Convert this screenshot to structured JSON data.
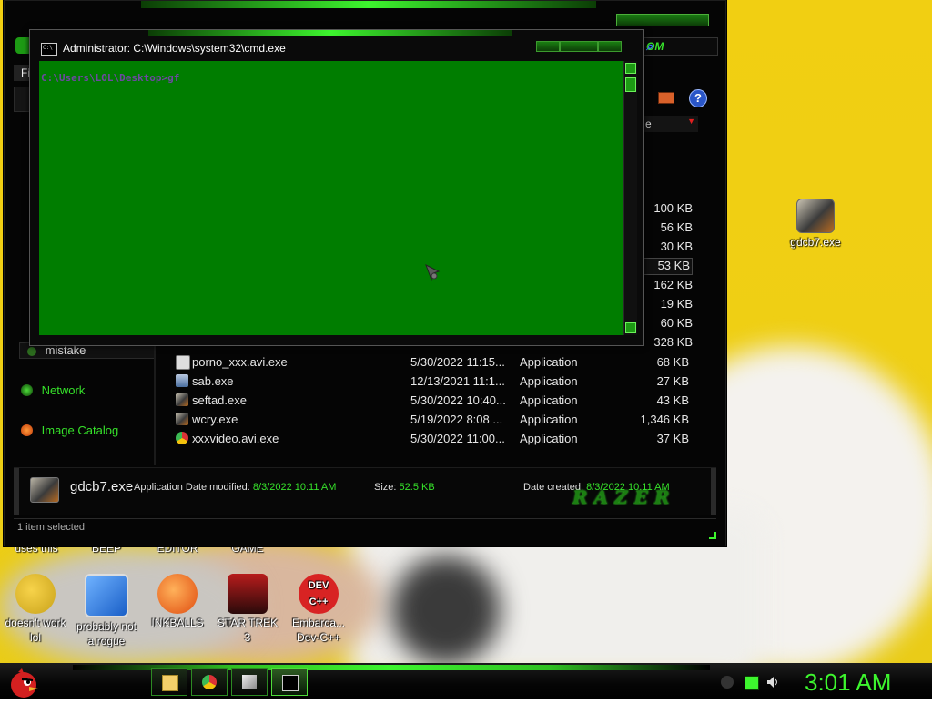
{
  "desktop": {
    "top_labels": [
      "uses this",
      "BEEP",
      "EDITOR",
      "GAME"
    ],
    "icons": [
      {
        "label1": "doesn't work",
        "label2": "lol",
        "icon": "yahoo-messenger-icon"
      },
      {
        "label1": "probably not",
        "label2": "a rogue",
        "icon": "monitor-gears-icon"
      },
      {
        "label1": "INKBALLS",
        "label2": "",
        "icon": "inkball-icon"
      },
      {
        "label1": "STAR TREK",
        "label2": "3",
        "icon": "star-trek-icon"
      },
      {
        "label1": "Embarca...",
        "label2": "Dev-C++",
        "icon": "dev-cpp-icon"
      }
    ],
    "right_icon": {
      "label": "gdcb7.exe",
      "icon": "exe-file-icon"
    }
  },
  "explorer": {
    "address_tail": "OM",
    "column_header_fragment": "e",
    "sizes_above": [
      "100 KB",
      "56 KB",
      "30 KB",
      "53 KB",
      "162 KB",
      "19 KB",
      "60 KB",
      "328 KB"
    ],
    "selected_size_index": 3,
    "hidden_row_type": "Application",
    "sidebar": {
      "partial": "mistake",
      "network": "Network",
      "image_catalog": "Image Catalog"
    },
    "files": [
      {
        "name": "porno_xxx.avi.exe",
        "date": "5/30/2022 11:15...",
        "type": "Application",
        "size": "68 KB"
      },
      {
        "name": "sab.exe",
        "date": "12/13/2021 11:1...",
        "type": "Application",
        "size": "27 KB"
      },
      {
        "name": "seftad.exe",
        "date": "5/30/2022 10:40...",
        "type": "Application",
        "size": "43 KB"
      },
      {
        "name": "wcry.exe",
        "date": "5/19/2022 8:08 ...",
        "type": "Application",
        "size": "1,346 KB"
      },
      {
        "name": "xxxvideo.avi.exe",
        "date": "5/30/2022 11:00...",
        "type": "Application",
        "size": "37 KB"
      }
    ],
    "details": {
      "name": "gdcb7.exe",
      "type": "Application",
      "date_modified_label": "Date modified:",
      "date_modified": "8/3/2022 10:11 AM",
      "size_label": "Size:",
      "size": "52.5 KB",
      "date_created_label": "Date created:",
      "date_created": "8/3/2022 10:11 AM",
      "brand": "RAZER"
    },
    "status": "1 item selected",
    "menu_fragment": "Fi"
  },
  "cmd": {
    "title": "Administrator: C:\\Windows\\system32\\cmd.exe",
    "prompt": "C:\\Users\\LOL\\Desktop>gf"
  },
  "taskbar": {
    "clock": "3:01 AM"
  },
  "colors": {
    "accent": "#3df52e",
    "console_bg": "#007d00",
    "desktop_bg": "#f1cf12"
  }
}
